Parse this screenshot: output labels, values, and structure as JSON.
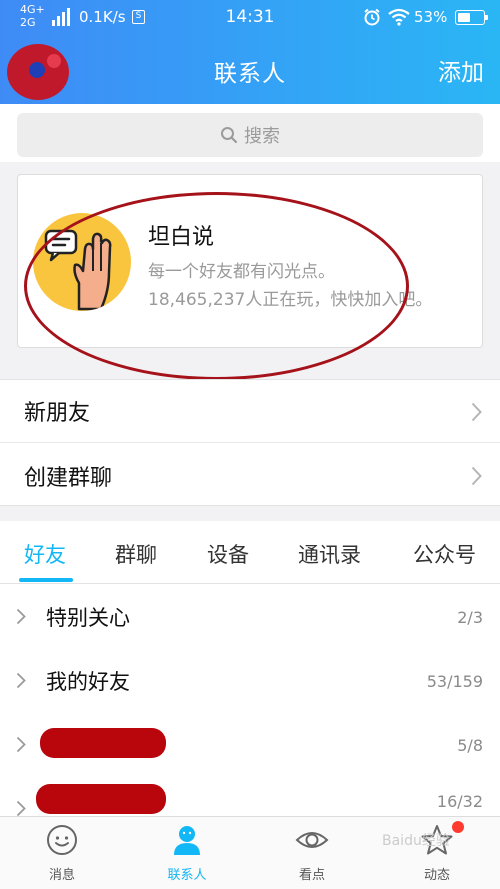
{
  "status_bar": {
    "network_top": "4G+",
    "network_bottom": "2G",
    "speed": "0.1K/s",
    "s_badge": "S",
    "time": "14:31",
    "battery_percent": "53%",
    "battery_level": 0.53
  },
  "header": {
    "title": "联系人",
    "add_label": "添加"
  },
  "search": {
    "placeholder": "搜索"
  },
  "promo": {
    "title": "坦白说",
    "subtitle": "每一个好友都有闪光点。",
    "players_text": "18,465,237人正在玩，快快加入吧。"
  },
  "menu": {
    "items": [
      {
        "label": "新朋友"
      },
      {
        "label": "创建群聊"
      }
    ]
  },
  "tabs": [
    {
      "label": "好友",
      "active": true
    },
    {
      "label": "群聊"
    },
    {
      "label": "设备"
    },
    {
      "label": "通讯录"
    },
    {
      "label": "公众号"
    }
  ],
  "groups": [
    {
      "name": "特别关心",
      "count": "2/3"
    },
    {
      "name": "我的好友",
      "count": "53/159"
    },
    {
      "name": "",
      "count": "5/8",
      "redacted": true
    },
    {
      "name": "",
      "count": "16/32",
      "redacted": true
    }
  ],
  "bottom_nav": [
    {
      "label": "消息",
      "icon": "chat-face-icon"
    },
    {
      "label": "联系人",
      "icon": "contact-icon",
      "active": true
    },
    {
      "label": "看点",
      "icon": "eye-icon"
    },
    {
      "label": "动态",
      "icon": "star-icon",
      "has_badge": true
    }
  ],
  "watermark": "Baidu经验",
  "colors": {
    "accent": "#12b7f5",
    "header_start": "#3f8bf6",
    "header_end": "#2ab6f5",
    "annotation_red": "#a5121a"
  }
}
